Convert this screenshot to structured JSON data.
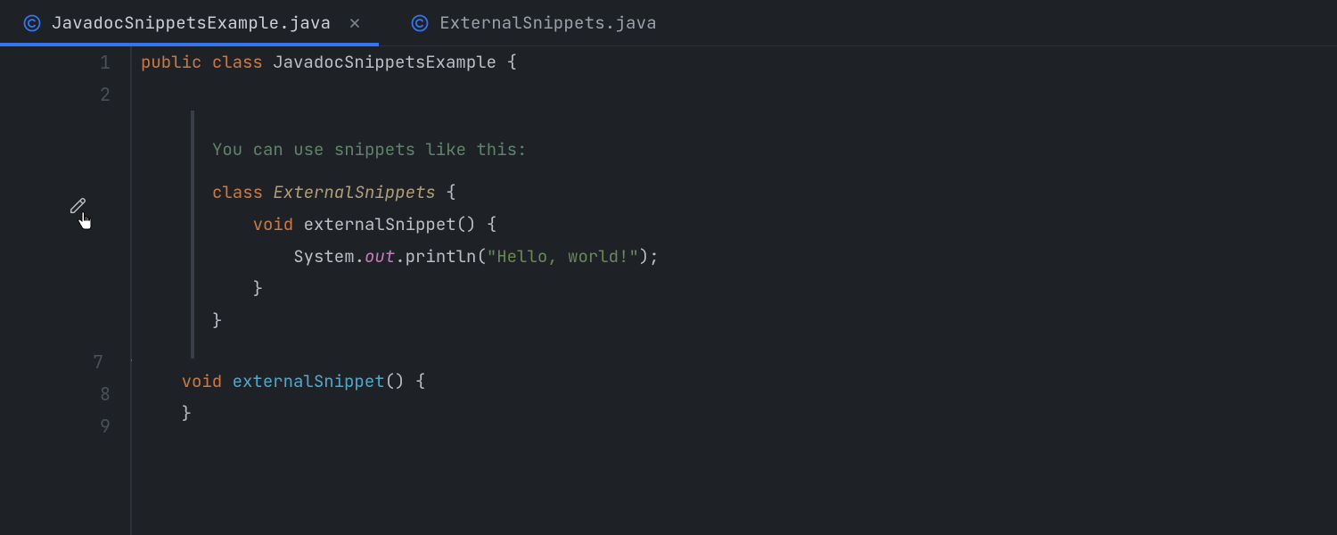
{
  "tabs": [
    {
      "label": "JavadocSnippetsExample.java",
      "active": true
    },
    {
      "label": "ExternalSnippets.java",
      "active": false
    }
  ],
  "gutter": {
    "lines": [
      "1",
      "2",
      "",
      "7",
      "8",
      "9"
    ]
  },
  "code": {
    "l1": {
      "kw1": "public",
      "kw2": "class",
      "cls": "JavadocSnippetsExample",
      "brace": " {"
    },
    "doc": {
      "intro": "You can use snippets like this:",
      "s1_kw": "class ",
      "s1_cls": "ExternalSnippets",
      "s1_rest": " {",
      "s2_indent": "    ",
      "s2_kw": "void ",
      "s2_name": "externalSnippet",
      "s2_rest": "() {",
      "s3_indent": "        ",
      "s3_a": "System",
      "s3_dot1": ".",
      "s3_b": "out",
      "s3_dot2": ".",
      "s3_c": "println",
      "s3_paren": "(",
      "s3_str": "\"Hello, world!\"",
      "s3_end": ");",
      "s4": "    }",
      "s5": "}"
    },
    "l7": {
      "indent": "    ",
      "kw": "void ",
      "name": "externalSnippet",
      "rest": "() {"
    },
    "l8": "    }",
    "l9": ""
  }
}
